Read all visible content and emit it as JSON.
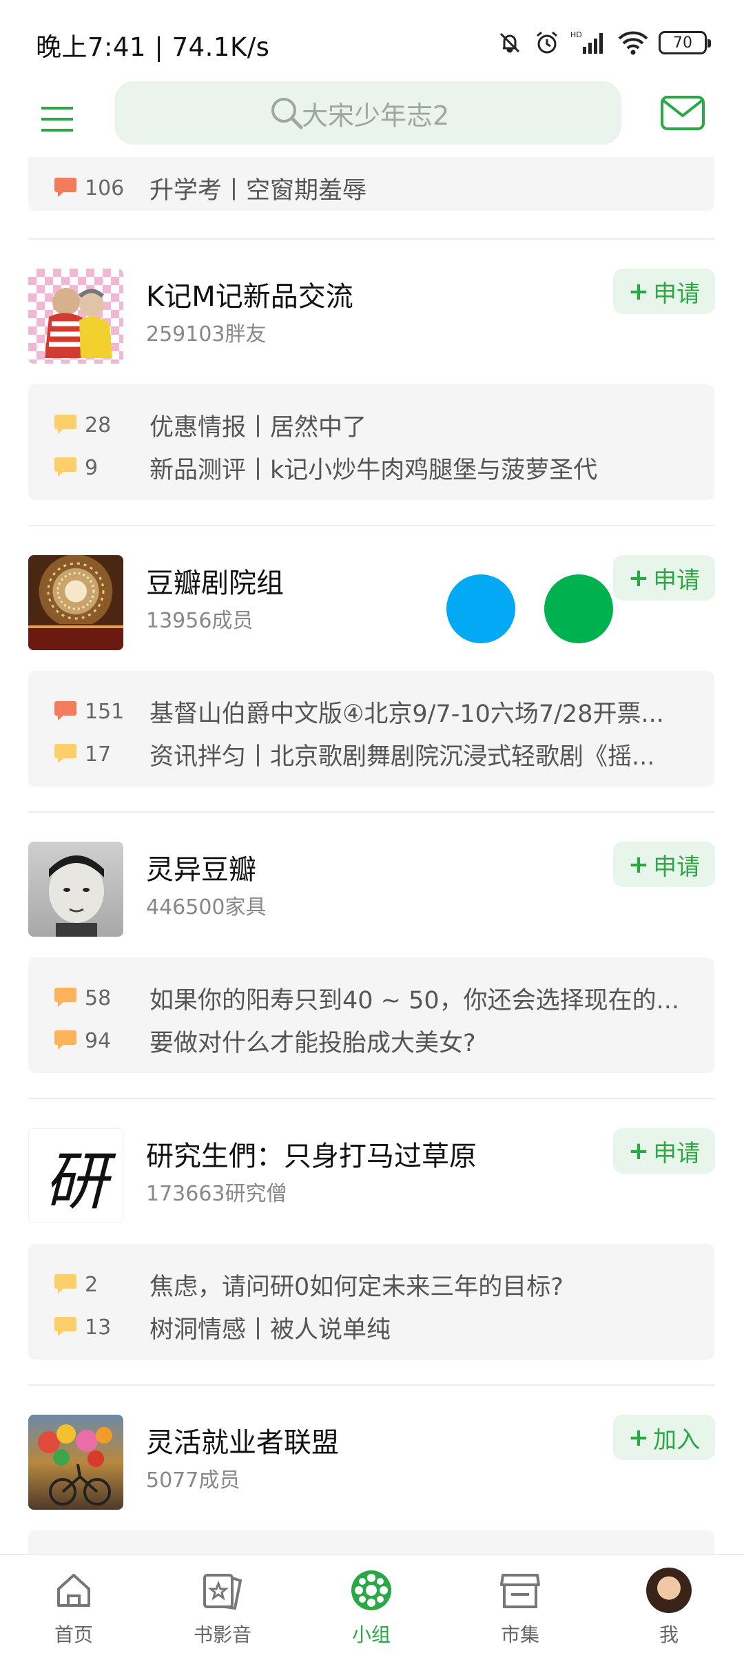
{
  "status_bar": {
    "time": "晚上7:41 | 74.1K/s",
    "battery": "70",
    "icons": [
      "mute-icon",
      "alarm-icon",
      "hd-signal-icon",
      "wifi-icon",
      "battery-icon"
    ]
  },
  "header": {
    "search_placeholder": "大宋少年志2",
    "icons": [
      "menu-icon",
      "search-icon",
      "mail-icon"
    ],
    "accent_color": "#2aa845"
  },
  "top_partial_post": {
    "count": "106",
    "title": "升学考丨空窗期羞辱"
  },
  "groups": [
    {
      "name": "K记M记新品交流",
      "members": "259103胖友",
      "action": "申请",
      "posts": [
        {
          "count": "28",
          "title": "优惠情报丨居然中了"
        },
        {
          "count": "9",
          "title": "新品测评丨k记小炒牛肉鸡腿堡与菠萝圣代"
        }
      ]
    },
    {
      "name": "豆瓣剧院组",
      "members": "13956成员",
      "action": "申请",
      "posts": [
        {
          "count": "151",
          "title": "基督山伯爵中文版④北京9/7-10六场7/28开票..."
        },
        {
          "count": "17",
          "title": "资讯拌匀丨北京歌剧舞剧院沉浸式轻歌剧《摇..."
        }
      ]
    },
    {
      "name": "灵异豆瓣",
      "members": "446500家具",
      "action": "申请",
      "posts": [
        {
          "count": "58",
          "title": "如果你的阳寿只到40 ~ 50，你还会选择现在的..."
        },
        {
          "count": "94",
          "title": "要做对什么才能投胎成大美女?"
        }
      ]
    },
    {
      "name": "研究生們：只身打马过草原",
      "members": "173663研究僧",
      "action": "申请",
      "avatar_text": "研",
      "posts": [
        {
          "count": "2",
          "title": "焦虑，请问研0如何定未来三年的目标?"
        },
        {
          "count": "13",
          "title": "树洞情感丨被人说单纯"
        }
      ]
    },
    {
      "name": "灵活就业者联盟",
      "members": "5077成员",
      "action": "加入",
      "posts": []
    }
  ],
  "floating_dots": [
    {
      "color": "#03a9f4"
    },
    {
      "color": "#00b14f"
    }
  ],
  "bottom_nav": {
    "items": [
      {
        "label": "首页",
        "icon": "home-icon",
        "active": false
      },
      {
        "label": "书影音",
        "icon": "book-movie-icon",
        "active": false
      },
      {
        "label": "小组",
        "icon": "group-icon",
        "active": true
      },
      {
        "label": "市集",
        "icon": "market-icon",
        "active": false
      },
      {
        "label": "我",
        "icon": "profile-avatar",
        "active": false
      }
    ]
  }
}
